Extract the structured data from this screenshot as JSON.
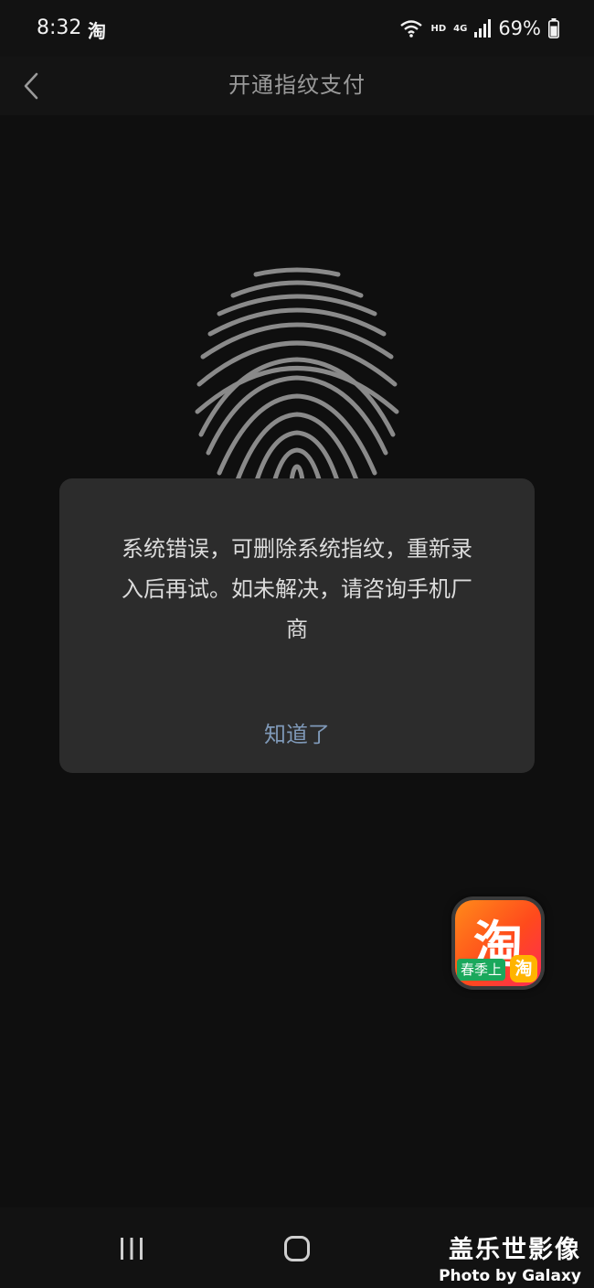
{
  "status_bar": {
    "time": "8:32",
    "app_indicator": "淘",
    "network_hd": "HD",
    "network_4g": "4G",
    "battery_percent": "69%"
  },
  "header": {
    "title": "开通指纹支付",
    "back_icon": "chevron-left-icon"
  },
  "fingerprint": {
    "icon": "fingerprint-icon",
    "color": "#8a8a8a"
  },
  "dialog": {
    "message_line1": "系统错误，可删除系统指纹，重新录",
    "message_line2": "入后再试。如未解决，请咨询手机厂",
    "message_line3": "商",
    "confirm_label": "知道了"
  },
  "floating_app": {
    "main_char": "淘",
    "badge_text": "春季上",
    "badge_char": "淘"
  },
  "bottom_nav": {
    "recents_icon": "recents-icon",
    "home_icon": "home-icon"
  },
  "watermark": {
    "title": "盖乐世影像",
    "subtitle": "Photo by Galaxy"
  },
  "colors": {
    "background": "#0f0f0f",
    "dialog_bg": "#2c2c2c",
    "accent_link": "#7f99b8"
  }
}
